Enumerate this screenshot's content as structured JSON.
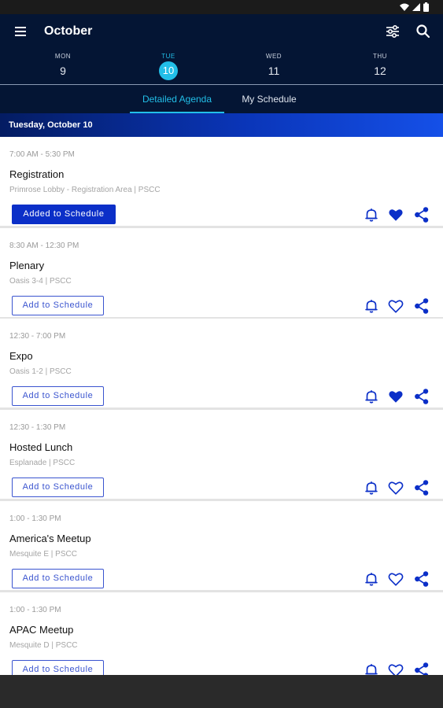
{
  "app": {
    "title": "October"
  },
  "days": [
    {
      "dow": "MON",
      "num": "9"
    },
    {
      "dow": "TUE",
      "num": "10"
    },
    {
      "dow": "WED",
      "num": "11"
    },
    {
      "dow": "THU",
      "num": "12"
    }
  ],
  "tabs": [
    {
      "label": "Detailed Agenda"
    },
    {
      "label": "My Schedule"
    }
  ],
  "date_header": "Tuesday, October 10",
  "events": [
    {
      "time": "7:00 AM - 5:30 PM",
      "title": "Registration",
      "location": "Primrose Lobby - Registration Area | PSCC",
      "button": "Added to Schedule",
      "favorite": true
    },
    {
      "time": "8:30 AM - 12:30 PM",
      "title": "Plenary",
      "location": "Oasis 3-4 | PSCC",
      "button": "Add to Schedule",
      "favorite": false
    },
    {
      "time": "12:30 - 7:00 PM",
      "title": "Expo",
      "location": "Oasis 1-2 | PSCC",
      "button": "Add to Schedule",
      "favorite": true
    },
    {
      "time": "12:30 - 1:30 PM",
      "title": "Hosted Lunch",
      "location": "Esplanade | PSCC",
      "button": "Add to Schedule",
      "favorite": false
    },
    {
      "time": "1:00 - 1:30 PM",
      "title": "America's Meetup",
      "location": "Mesquite E | PSCC",
      "button": "Add to Schedule",
      "favorite": false
    },
    {
      "time": "1:00 - 1:30 PM",
      "title": "APAC Meetup",
      "location": "Mesquite D | PSCC",
      "button": "Add to Schedule",
      "favorite": false
    }
  ],
  "colors": {
    "appbar": "#041534",
    "accent": "#22bfe8",
    "primary": "#0b2fc8"
  }
}
